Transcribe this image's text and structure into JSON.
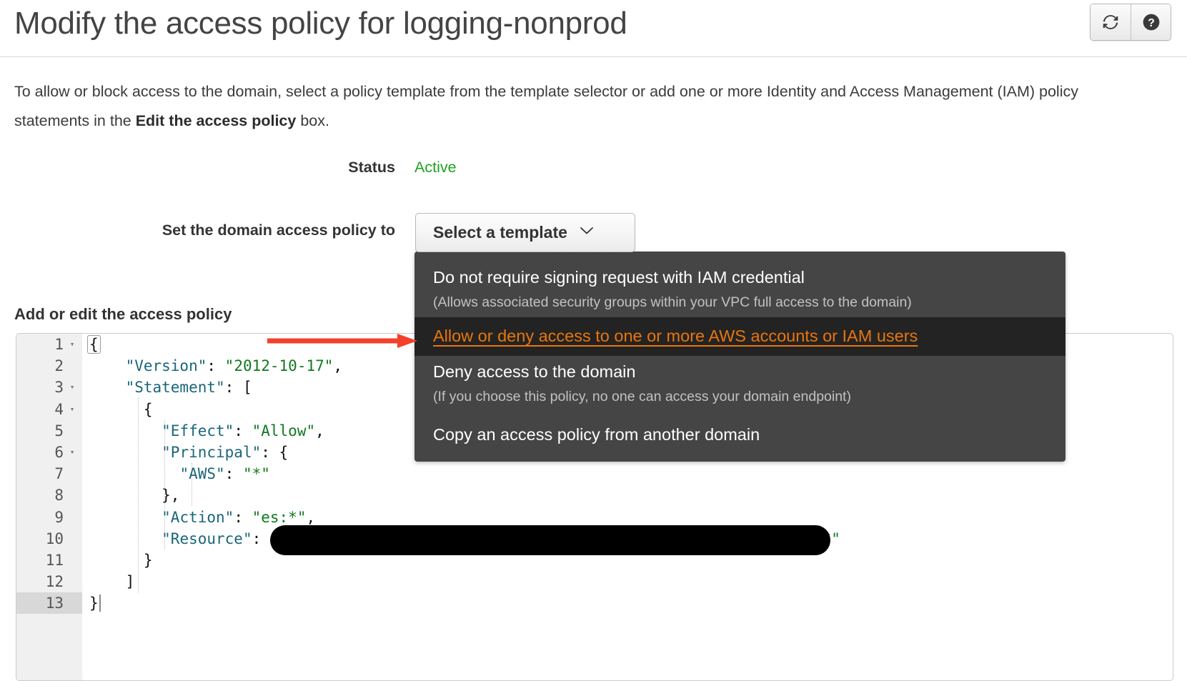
{
  "header": {
    "title": "Modify the access policy for logging-nonprod",
    "refresh_icon": "refresh-icon",
    "help_icon": "help-icon"
  },
  "description": {
    "part1": "To allow or block access to the domain, select a policy template from the template selector or add one or more Identity and Access Management (IAM) policy statements in the ",
    "bold": "Edit the access policy",
    "part2": " box."
  },
  "status": {
    "label": "Status",
    "value": "Active",
    "value_color": "#1fa01f"
  },
  "policy_selector": {
    "label": "Set the domain access policy to",
    "button_label": "Select a template",
    "caret_icon": "chevron-down-icon",
    "menu": [
      {
        "title": "Do not require signing request with IAM credential",
        "subtitle": "(Allows associated security groups within your VPC full access to the domain)",
        "highlighted": false
      },
      {
        "title": "Allow or deny access to one or more AWS accounts or IAM users",
        "subtitle": "",
        "highlighted": true
      },
      {
        "title": "Deny access to the domain",
        "subtitle": "(If you choose this policy, no one can access your domain endpoint)",
        "highlighted": false
      },
      {
        "title": "Copy an access policy from another domain",
        "subtitle": "",
        "highlighted": false
      }
    ],
    "highlight_color": "#e8760c",
    "menu_bg": "#454545",
    "menu_highlight_bg": "#232323"
  },
  "editor": {
    "heading": "Add or edit the access policy",
    "active_line": 13,
    "cursor_line": 13,
    "gutter": [
      {
        "num": "1",
        "fold": "▾"
      },
      {
        "num": "2",
        "fold": ""
      },
      {
        "num": "3",
        "fold": "▾"
      },
      {
        "num": "4",
        "fold": "▾"
      },
      {
        "num": "5",
        "fold": ""
      },
      {
        "num": "6",
        "fold": "▾"
      },
      {
        "num": "7",
        "fold": ""
      },
      {
        "num": "8",
        "fold": ""
      },
      {
        "num": "9",
        "fold": ""
      },
      {
        "num": "10",
        "fold": ""
      },
      {
        "num": "11",
        "fold": ""
      },
      {
        "num": "12",
        "fold": ""
      },
      {
        "num": "13",
        "fold": ""
      }
    ],
    "lines": [
      "{",
      "    \"Version\": \"2012-10-17\",",
      "    \"Statement\": [",
      "        {",
      "            \"Effect\": \"Allow\",",
      "            \"Principal\": {",
      "                \"AWS\": \"*\"",
      "            },",
      "            \"Action\": \"es:*\",",
      "            \"Resource\": \"",
      "        }",
      "    ]",
      "}"
    ],
    "redacted_tail": "*\"",
    "syntax_colors": {
      "key": "#19667a",
      "string": "#0f7a1e",
      "punctuation": "#111111"
    }
  },
  "annotation": {
    "arrow_color": "#f4402a",
    "arrow_points_to": "Allow or deny access to one or more AWS accounts or IAM users"
  }
}
